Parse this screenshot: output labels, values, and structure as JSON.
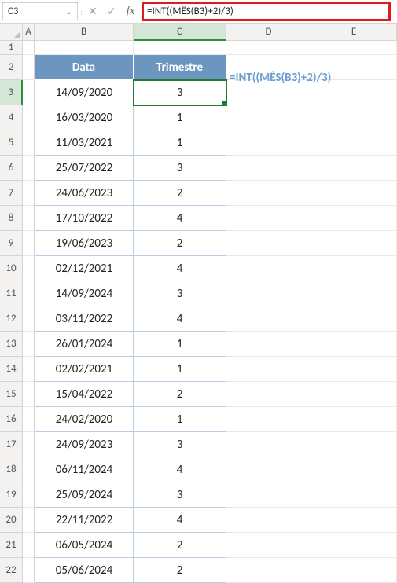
{
  "name_box": "C3",
  "formula": "=INT((MÊS(B3)+2)/3)",
  "overlay_formula": "=INT((MÊS(B3)+2)/3)",
  "columns": {
    "A": "A",
    "B": "B",
    "C": "C",
    "D": "D",
    "E": "E"
  },
  "headers": {
    "data": "Data",
    "trimestre": "Trimestre"
  },
  "row_labels": [
    "1",
    "2",
    "3",
    "4",
    "5",
    "6",
    "7",
    "8",
    "9",
    "10",
    "11",
    "12",
    "13",
    "14",
    "15",
    "16",
    "17",
    "18",
    "19",
    "20",
    "21",
    "22"
  ],
  "chart_data": {
    "type": "table",
    "title": "",
    "columns": [
      "Data",
      "Trimestre"
    ],
    "rows": [
      {
        "data": "14/09/2020",
        "trimestre": "3"
      },
      {
        "data": "16/03/2020",
        "trimestre": "1"
      },
      {
        "data": "11/03/2021",
        "trimestre": "1"
      },
      {
        "data": "25/07/2022",
        "trimestre": "3"
      },
      {
        "data": "24/06/2023",
        "trimestre": "2"
      },
      {
        "data": "17/10/2022",
        "trimestre": "4"
      },
      {
        "data": "19/06/2023",
        "trimestre": "2"
      },
      {
        "data": "02/12/2021",
        "trimestre": "4"
      },
      {
        "data": "14/09/2024",
        "trimestre": "3"
      },
      {
        "data": "03/11/2022",
        "trimestre": "4"
      },
      {
        "data": "26/01/2024",
        "trimestre": "1"
      },
      {
        "data": "02/02/2021",
        "trimestre": "1"
      },
      {
        "data": "15/04/2022",
        "trimestre": "2"
      },
      {
        "data": "24/02/2020",
        "trimestre": "1"
      },
      {
        "data": "24/09/2023",
        "trimestre": "3"
      },
      {
        "data": "06/11/2024",
        "trimestre": "4"
      },
      {
        "data": "25/09/2024",
        "trimestre": "3"
      },
      {
        "data": "22/11/2022",
        "trimestre": "4"
      },
      {
        "data": "06/05/2024",
        "trimestre": "2"
      },
      {
        "data": "05/06/2024",
        "trimestre": "2"
      }
    ]
  },
  "selected": {
    "row_index": 0,
    "col": "C"
  },
  "icons": {
    "fx": "fx",
    "cancel": "✕",
    "enter": "✓",
    "chev": "⌄",
    "dots": "⋮"
  }
}
